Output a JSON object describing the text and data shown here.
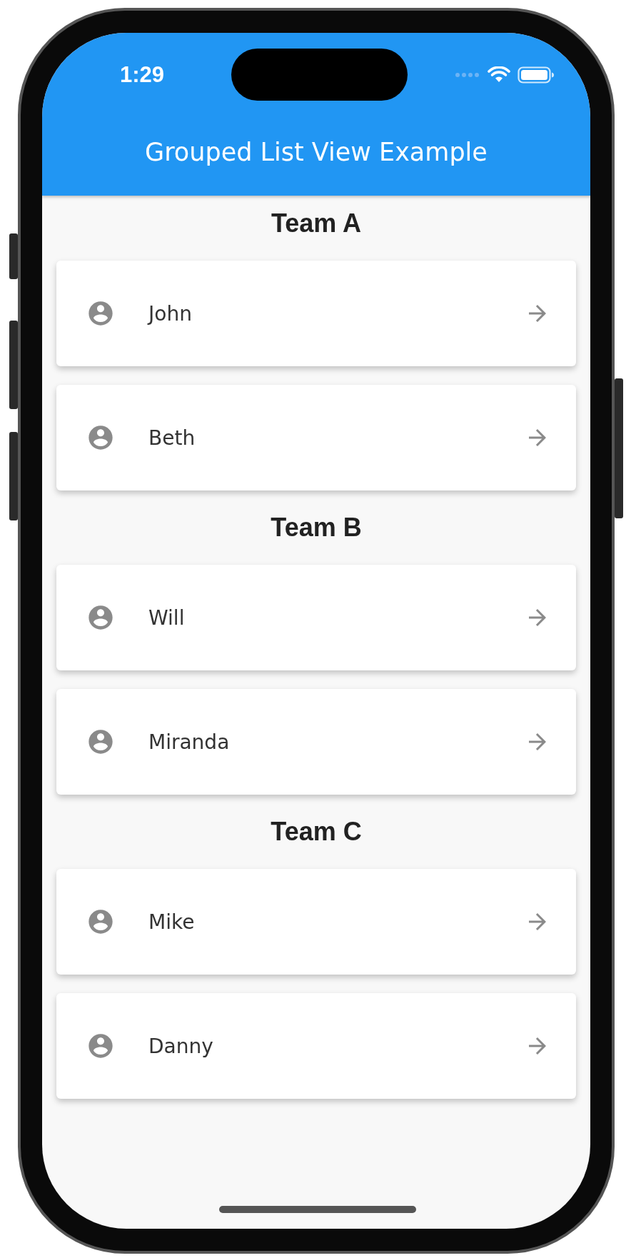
{
  "status_bar": {
    "time": "1:29"
  },
  "app_bar": {
    "title": "Grouped List View Example"
  },
  "groups": [
    {
      "title": "Team A",
      "members": [
        {
          "name": "John"
        },
        {
          "name": "Beth"
        }
      ]
    },
    {
      "title": "Team B",
      "members": [
        {
          "name": "Will"
        },
        {
          "name": "Miranda"
        }
      ]
    },
    {
      "title": "Team C",
      "members": [
        {
          "name": "Mike"
        },
        {
          "name": "Danny"
        }
      ]
    }
  ]
}
